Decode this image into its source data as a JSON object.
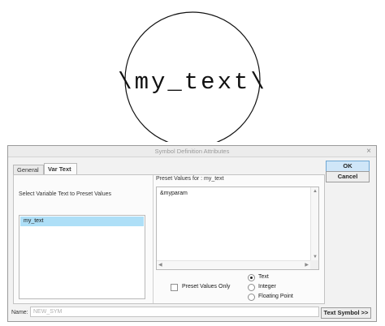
{
  "preview": {
    "symbol_text": "\\my_text\\"
  },
  "dialog": {
    "title": "Symbol Definition Attributes",
    "close_glyph": "×",
    "tabs": [
      {
        "label": "General"
      },
      {
        "label": "Var Text"
      }
    ],
    "active_tab": "Var Text",
    "left_label": "Select Variable Text to Preset Values",
    "variables": [
      {
        "label": "my_text"
      }
    ],
    "selected_variable": "my_text",
    "preset_label": "Preset Values for :  my_text",
    "preset_values": "&myparam",
    "preset_values_only": {
      "label": "Preset Values Only",
      "checked": false
    },
    "value_type": {
      "options": [
        {
          "label": "Text"
        },
        {
          "label": "Integer"
        },
        {
          "label": "Floating Point"
        }
      ],
      "selected": "Text"
    },
    "buttons": {
      "ok": "OK",
      "cancel": "Cancel",
      "text_symbol": "Text Symbol >>"
    },
    "name": {
      "label": "Name:",
      "placeholder": "NEW_SYM"
    },
    "accent_color": "#aedff7"
  }
}
